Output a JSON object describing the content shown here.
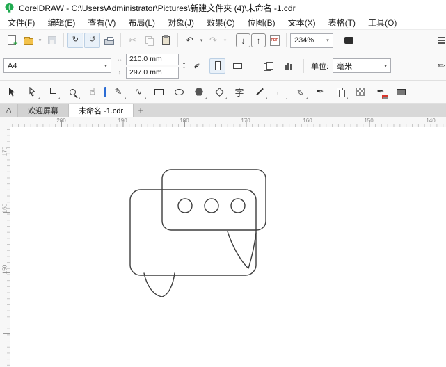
{
  "window": {
    "title": "CorelDRAW - C:\\Users\\Administrator\\Pictures\\新建文件夹 (4)\\未命名 -1.cdr"
  },
  "menubar": {
    "items": [
      "文件(F)",
      "编辑(E)",
      "查看(V)",
      "布局(L)",
      "对象(J)",
      "效果(C)",
      "位图(B)",
      "文本(X)",
      "表格(T)",
      "工具(O)"
    ]
  },
  "toolbar": {
    "zoom_level": "234%",
    "pdf_label": "PDF"
  },
  "property_bar": {
    "page_preset": "A4",
    "page_width": "210.0 mm",
    "page_height": "297.0 mm",
    "units_label": "单位:",
    "units_value": "毫米"
  },
  "toolbox": {
    "text_tool_glyph": "字"
  },
  "tabs": {
    "welcome": "欢迎屏幕",
    "document": "未命名 -1.cdr",
    "add": "+"
  },
  "rulers": {
    "horizontal": [
      "200",
      "190",
      "180",
      "170",
      "160",
      "150",
      "140"
    ],
    "vertical": [
      "170",
      "160",
      "150"
    ]
  }
}
